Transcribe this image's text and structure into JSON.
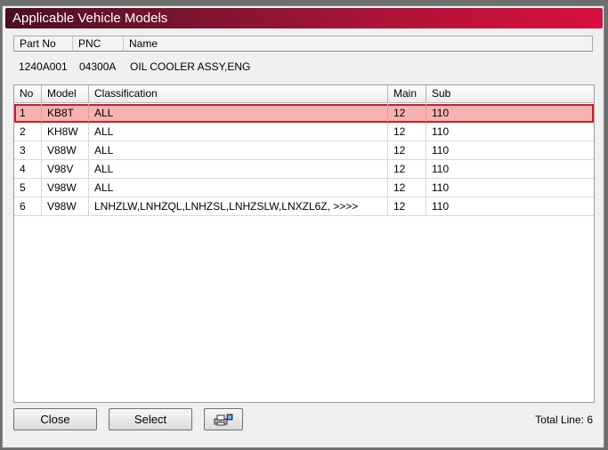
{
  "window": {
    "title": "Applicable Vehicle Models"
  },
  "info": {
    "headers": [
      "Part No",
      "PNC",
      "Name"
    ],
    "values": [
      "1240A001",
      "04300A",
      "OIL COOLER ASSY,ENG"
    ]
  },
  "list": {
    "headers": [
      "No",
      "Model",
      "Classification",
      "Main",
      "Sub"
    ],
    "rows": [
      [
        "1",
        "KB8T",
        "ALL",
        "12",
        "110"
      ],
      [
        "2",
        "KH8W",
        "ALL",
        "12",
        "110"
      ],
      [
        "3",
        "V88W",
        "ALL",
        "12",
        "110"
      ],
      [
        "4",
        "V98V",
        "ALL",
        "12",
        "110"
      ],
      [
        "5",
        "V98W",
        "ALL",
        "12",
        "110"
      ],
      [
        "6",
        "V98W",
        "LNHZLW,LNHZQL,LNHZSL,LNHZSLW,LNXZL6Z,  >>>>",
        "12",
        "110"
      ]
    ],
    "selected_row": 0
  },
  "buttons": {
    "close": "Close",
    "select": "Select",
    "print_icon": "printer-icon"
  },
  "footer": {
    "total_label": "Total Line:",
    "total_value": "6"
  }
}
